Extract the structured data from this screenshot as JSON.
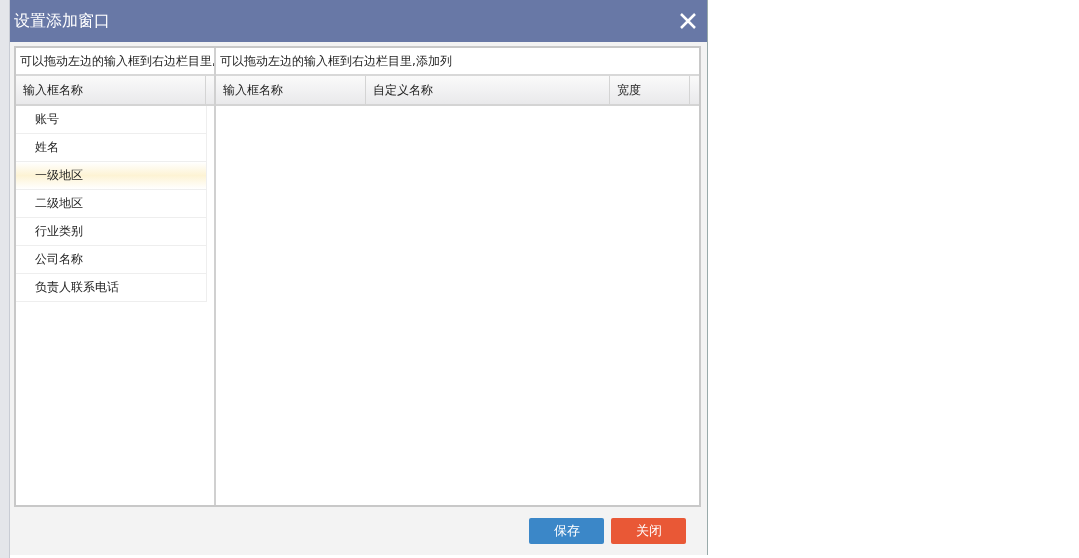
{
  "window": {
    "title": "设置添加窗口"
  },
  "left_panel": {
    "hint": "可以拖动左边的输入框到右边栏目里,",
    "column": "输入框名称",
    "items": [
      {
        "label": "账号",
        "selected": false
      },
      {
        "label": "姓名",
        "selected": false
      },
      {
        "label": "一级地区",
        "selected": true
      },
      {
        "label": "二级地区",
        "selected": false
      },
      {
        "label": "行业类别",
        "selected": false
      },
      {
        "label": "公司名称",
        "selected": false
      },
      {
        "label": "负责人联系电话",
        "selected": false
      }
    ]
  },
  "right_panel": {
    "hint": "可以拖动左边的输入框到右边栏目里,添加列",
    "columns": [
      "输入框名称",
      "自定义名称",
      "宽度"
    ]
  },
  "buttons": [
    {
      "label": "保存",
      "kind": "primary"
    },
    {
      "label": "关闭",
      "kind": "danger"
    }
  ]
}
